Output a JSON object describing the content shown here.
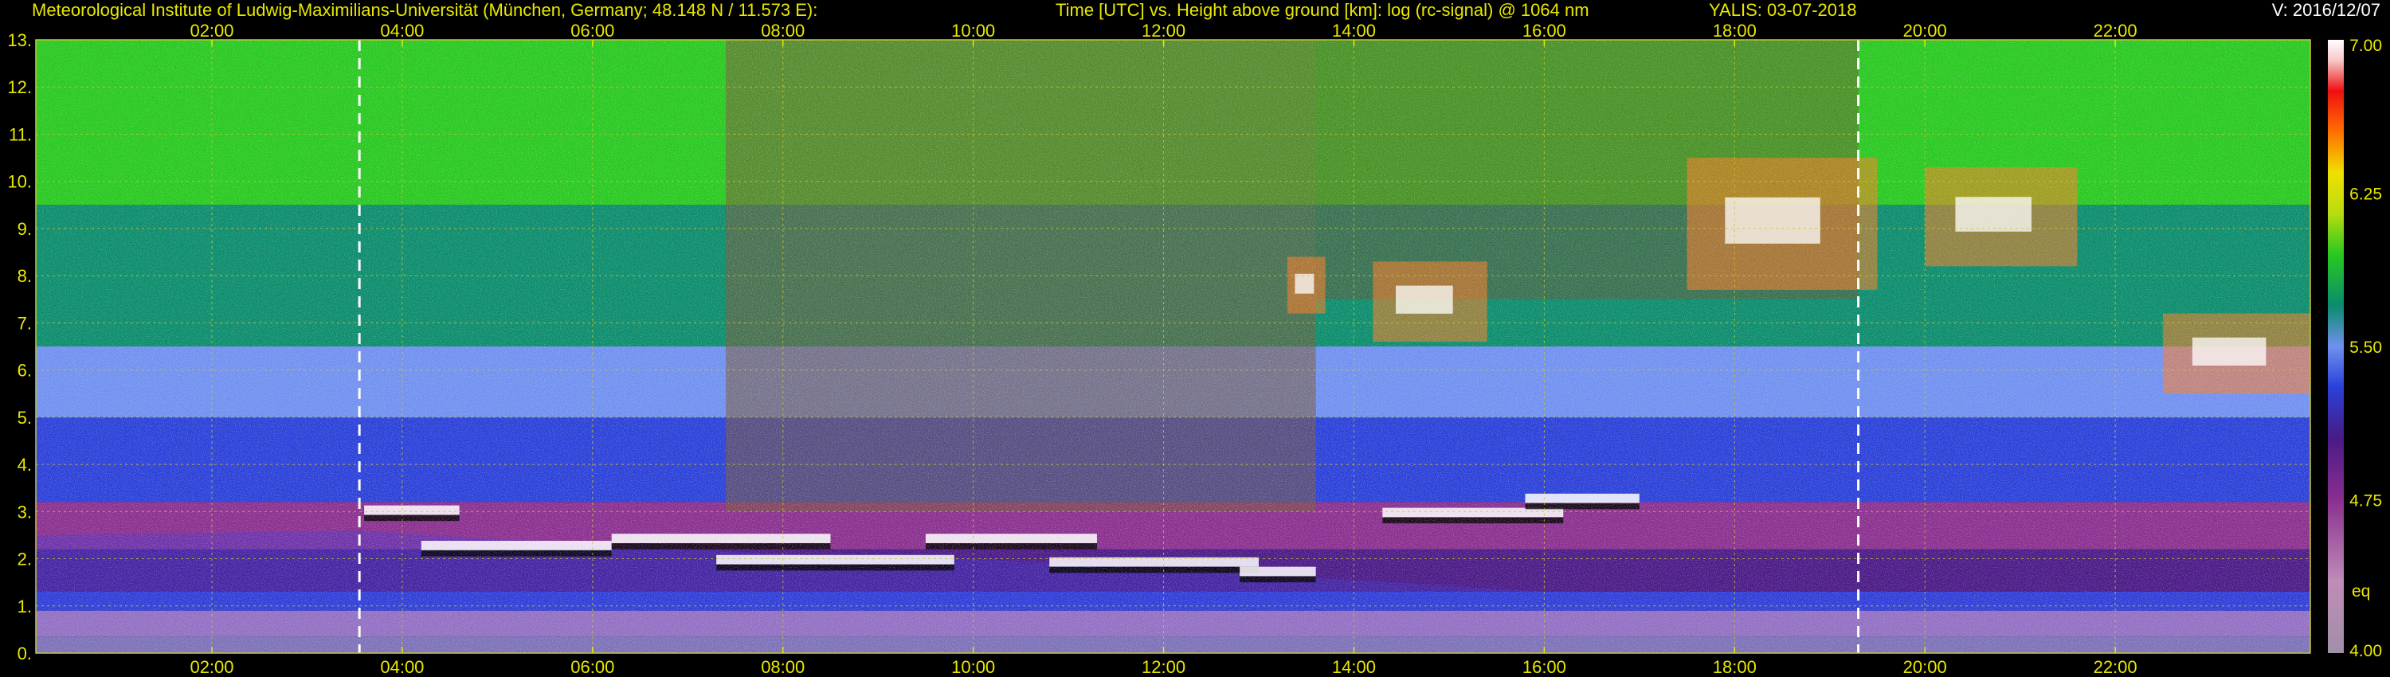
{
  "header": {
    "institute": "Meteorological Institute of Ludwig-Maximilians-Universität (München, Germany; 48.148 N / 11.573 E):",
    "title": "Time [UTC] vs. Height above ground [km]: log (rc-signal) @ 1064 nm",
    "station_date": "YALIS: 03-07-2018",
    "version": "V: 2016/12/07"
  },
  "colors": {
    "background": "#000000",
    "text": "#e8e800",
    "grid": "#c8c832",
    "marker": "#ffffff"
  },
  "chart_data": {
    "type": "heatmap",
    "title": "Time [UTC] vs. Height above ground [km]: log (rc-signal) @ 1064 nm",
    "xlabel": "",
    "ylabel": "",
    "x_unit": "hours UTC",
    "xlim": [
      0.15,
      24.05
    ],
    "ylim": [
      0,
      13
    ],
    "x_ticks": [
      {
        "value": 2,
        "label": "02:00"
      },
      {
        "value": 4,
        "label": "04:00"
      },
      {
        "value": 6,
        "label": "06:00"
      },
      {
        "value": 8,
        "label": "08:00"
      },
      {
        "value": 10,
        "label": "10:00"
      },
      {
        "value": 12,
        "label": "12:00"
      },
      {
        "value": 14,
        "label": "14:00"
      },
      {
        "value": 16,
        "label": "16:00"
      },
      {
        "value": 18,
        "label": "18:00"
      },
      {
        "value": 20,
        "label": "20:00"
      },
      {
        "value": 22,
        "label": "22:00"
      }
    ],
    "y_ticks": [
      {
        "value": 0,
        "label": "0."
      },
      {
        "value": 1,
        "label": "1."
      },
      {
        "value": 2,
        "label": "2."
      },
      {
        "value": 3,
        "label": "3."
      },
      {
        "value": 4,
        "label": "4."
      },
      {
        "value": 5,
        "label": "5."
      },
      {
        "value": 6,
        "label": "6."
      },
      {
        "value": 7,
        "label": "7."
      },
      {
        "value": 8,
        "label": "8."
      },
      {
        "value": 9,
        "label": "9."
      },
      {
        "value": 10,
        "label": "10."
      },
      {
        "value": 11,
        "label": "11."
      },
      {
        "value": 12,
        "label": "12."
      },
      {
        "value": 13,
        "label": "13."
      }
    ],
    "grid": true,
    "vertical_markers": [
      3.55,
      19.3
    ],
    "colorbar": {
      "range": [
        4.0,
        7.0
      ],
      "labels": [
        {
          "value": 7.0,
          "label": "7.00"
        },
        {
          "value": 6.25,
          "label": "6.25"
        },
        {
          "value": 5.5,
          "label": "5.50"
        },
        {
          "value": 4.75,
          "label": "4.75"
        },
        {
          "value": 4.0,
          "label": "4.00"
        }
      ],
      "extra_label": "eq",
      "stops": [
        {
          "value": 4.0,
          "color": "#a090a8"
        },
        {
          "value": 4.35,
          "color": "#c08cb8"
        },
        {
          "value": 4.75,
          "color": "#8a2f8f"
        },
        {
          "value": 5.05,
          "color": "#4a1a86"
        },
        {
          "value": 5.3,
          "color": "#2a40d8"
        },
        {
          "value": 5.5,
          "color": "#7090f0"
        },
        {
          "value": 5.7,
          "color": "#0b8c6c"
        },
        {
          "value": 5.95,
          "color": "#28c820"
        },
        {
          "value": 6.15,
          "color": "#b8dc10"
        },
        {
          "value": 6.35,
          "color": "#f0e000"
        },
        {
          "value": 6.55,
          "color": "#ff7000"
        },
        {
          "value": 6.75,
          "color": "#ee1010"
        },
        {
          "value": 6.9,
          "color": "#f8c8c8"
        },
        {
          "value": 7.0,
          "color": "#ffffff"
        }
      ]
    },
    "features": {
      "aerosol_layer_top_km": [
        {
          "t": 0.15,
          "h": 2.5
        },
        {
          "t": 3.5,
          "h": 2.6
        },
        {
          "t": 6.0,
          "h": 2.3
        },
        {
          "t": 8.0,
          "h": 2.1
        },
        {
          "t": 10.0,
          "h": 2.0
        },
        {
          "t": 12.0,
          "h": 1.8
        },
        {
          "t": 13.6,
          "h": 1.6
        },
        {
          "t": 16.0,
          "h": 1.3
        },
        {
          "t": 20.0,
          "h": 1.3
        },
        {
          "t": 24.05,
          "h": 1.3
        }
      ],
      "low_clouds": [
        {
          "t0": 3.6,
          "t1": 4.6,
          "h": 3.05
        },
        {
          "t0": 4.2,
          "t1": 6.2,
          "h": 2.3
        },
        {
          "t0": 6.2,
          "t1": 8.5,
          "h": 2.45
        },
        {
          "t0": 7.3,
          "t1": 9.8,
          "h": 2.0
        },
        {
          "t0": 9.5,
          "t1": 11.3,
          "h": 2.45
        },
        {
          "t0": 10.8,
          "t1": 13.0,
          "h": 1.95
        },
        {
          "t0": 12.8,
          "t1": 13.6,
          "h": 1.75
        },
        {
          "t0": 14.3,
          "t1": 16.2,
          "h": 3.0
        },
        {
          "t0": 15.8,
          "t1": 17.0,
          "h": 3.3
        }
      ],
      "high_clouds": [
        {
          "t0": 13.3,
          "t1": 13.7,
          "h0": 7.2,
          "h1": 8.4
        },
        {
          "t0": 14.2,
          "t1": 15.4,
          "h0": 6.6,
          "h1": 8.3
        },
        {
          "t0": 17.5,
          "t1": 19.5,
          "h0": 7.7,
          "h1": 10.5
        },
        {
          "t0": 20.0,
          "t1": 21.6,
          "h0": 8.2,
          "h1": 10.3
        },
        {
          "t0": 22.5,
          "t1": 24.05,
          "h0": 5.5,
          "h1": 7.2
        }
      ]
    }
  }
}
